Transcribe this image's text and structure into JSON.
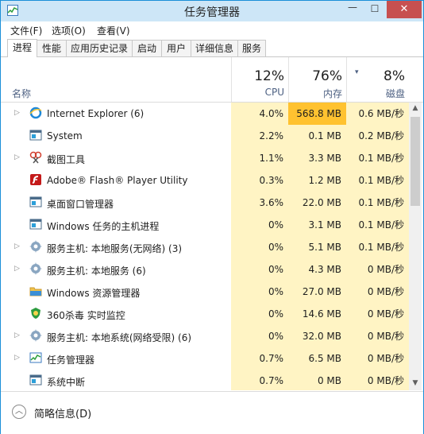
{
  "window": {
    "title": "任务管理器"
  },
  "controls": {
    "minimize": "—",
    "maximize": "☐",
    "close": "✕"
  },
  "menu": [
    "文件(F)",
    "选项(O)",
    "查看(V)"
  ],
  "tabs": [
    "进程",
    "性能",
    "应用历史记录",
    "启动",
    "用户",
    "详细信息",
    "服务"
  ],
  "header": {
    "name_label": "名称",
    "cpu": {
      "pct": "12%",
      "label": "CPU"
    },
    "memory": {
      "pct": "76%",
      "label": "内存"
    },
    "disk": {
      "pct": "8%",
      "label": "磁盘"
    }
  },
  "processes": [
    {
      "name": "Internet Explorer (6)",
      "cpu": "4.0%",
      "mem": "568.8 MB",
      "disk": "0.6 MB/秒",
      "expand": true,
      "icon": "ie-icon"
    },
    {
      "name": "System",
      "cpu": "2.2%",
      "mem": "0.1 MB",
      "disk": "0.2 MB/秒",
      "expand": false,
      "icon": "system-icon"
    },
    {
      "name": "截图工具",
      "cpu": "1.1%",
      "mem": "3.3 MB",
      "disk": "0.1 MB/秒",
      "expand": true,
      "icon": "snipping-tool-icon"
    },
    {
      "name": "Adobe® Flash® Player Utility",
      "cpu": "0.3%",
      "mem": "1.2 MB",
      "disk": "0.1 MB/秒",
      "expand": false,
      "icon": "flash-icon"
    },
    {
      "name": "桌面窗口管理器",
      "cpu": "3.6%",
      "mem": "22.0 MB",
      "disk": "0.1 MB/秒",
      "expand": false,
      "icon": "window-manager-icon"
    },
    {
      "name": "Windows 任务的主机进程",
      "cpu": "0%",
      "mem": "3.1 MB",
      "disk": "0.1 MB/秒",
      "expand": false,
      "icon": "host-process-icon"
    },
    {
      "name": "服务主机: 本地服务(无网络) (3)",
      "cpu": "0%",
      "mem": "5.1 MB",
      "disk": "0.1 MB/秒",
      "expand": true,
      "icon": "service-gear-icon"
    },
    {
      "name": "服务主机: 本地服务 (6)",
      "cpu": "0%",
      "mem": "4.3 MB",
      "disk": "0 MB/秒",
      "expand": true,
      "icon": "service-gear-icon"
    },
    {
      "name": "Windows 资源管理器",
      "cpu": "0%",
      "mem": "27.0 MB",
      "disk": "0 MB/秒",
      "expand": false,
      "icon": "explorer-folder-icon"
    },
    {
      "name": "360杀毒 实时监控",
      "cpu": "0%",
      "mem": "14.6 MB",
      "disk": "0 MB/秒",
      "expand": false,
      "icon": "antivirus-shield-icon"
    },
    {
      "name": "服务主机: 本地系统(网络受限) (6)",
      "cpu": "0%",
      "mem": "32.0 MB",
      "disk": "0 MB/秒",
      "expand": true,
      "icon": "service-gear-icon"
    },
    {
      "name": "任务管理器",
      "cpu": "0.7%",
      "mem": "6.5 MB",
      "disk": "0 MB/秒",
      "expand": true,
      "icon": "task-manager-icon"
    },
    {
      "name": "系统中断",
      "cpu": "0.7%",
      "mem": "0 MB",
      "disk": "0 MB/秒",
      "expand": false,
      "icon": "system-interrupt-icon"
    }
  ],
  "footer": {
    "fewer_details": "简略信息(D)"
  },
  "colors": {
    "heat_low": "#fff4c4",
    "heat_high": "#ffc230",
    "accent": "#1a8fd8"
  }
}
